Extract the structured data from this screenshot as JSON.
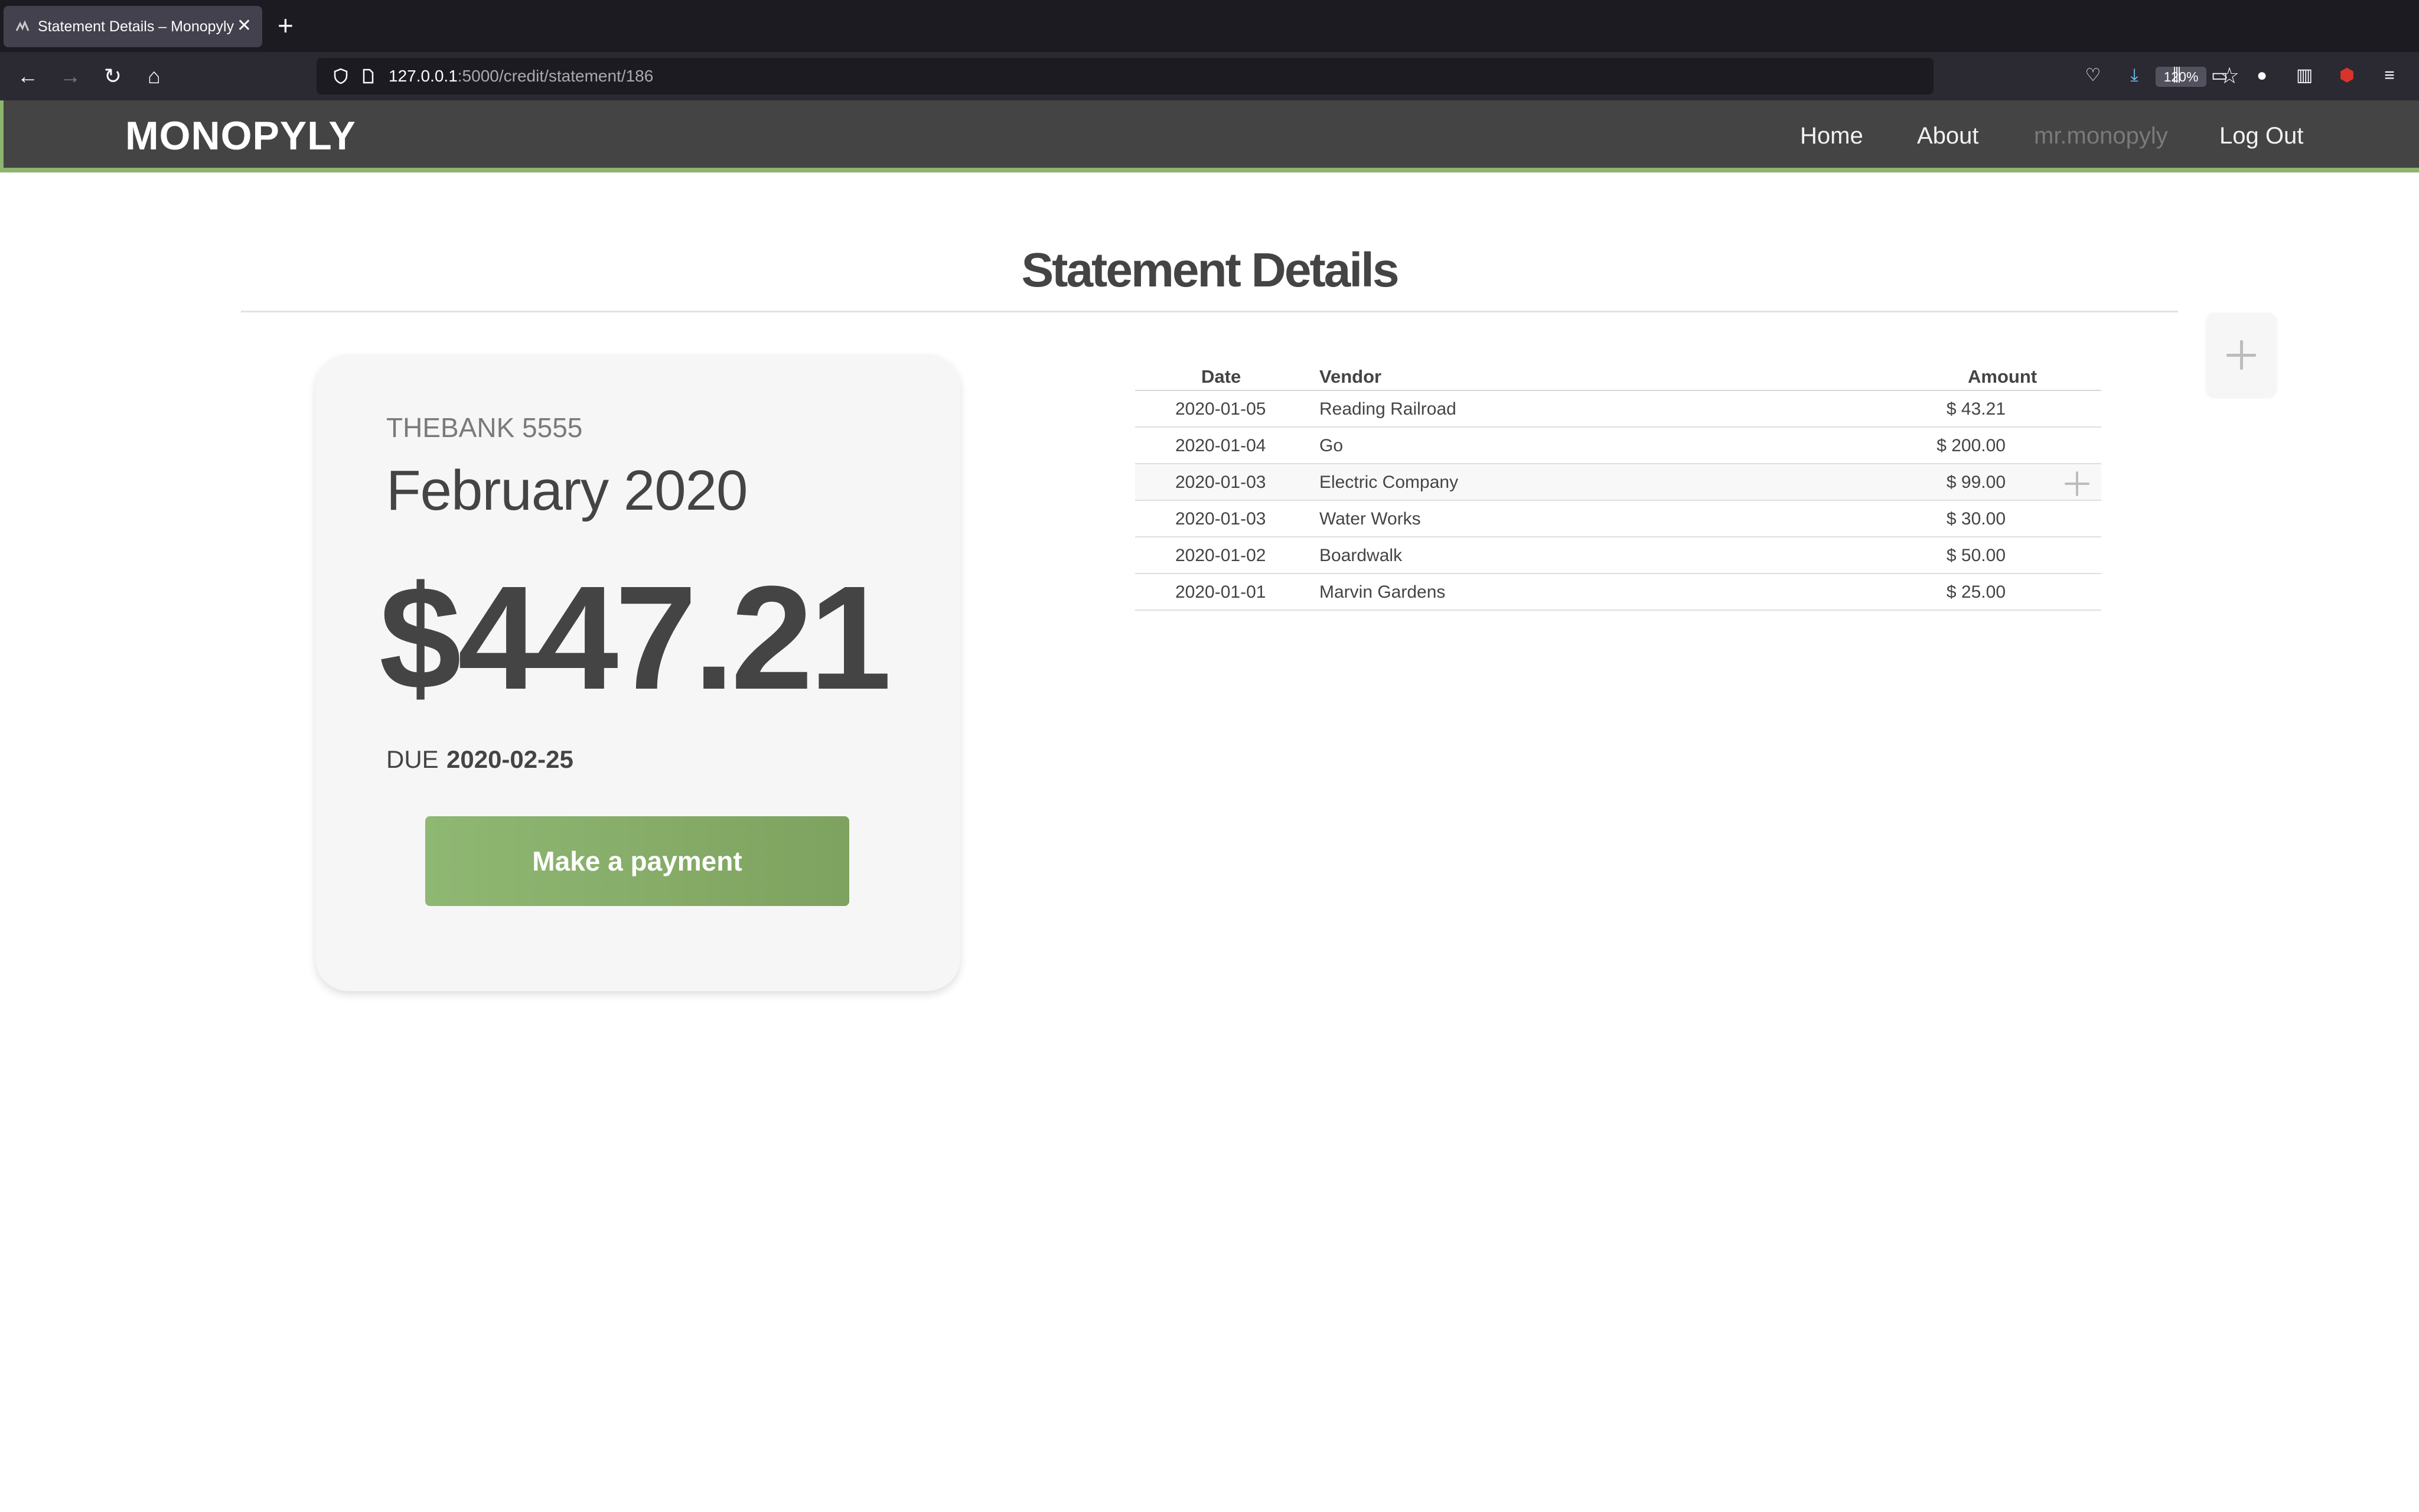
{
  "browser": {
    "tab_title": "Statement Details – Monopyly",
    "url_host": "127.0.0.1",
    "url_path": ":5000/credit/statement/186",
    "zoom": "120%"
  },
  "header": {
    "brand": "MONOPYLY",
    "nav": {
      "home": "Home",
      "about": "About",
      "user": "mr.monopyly",
      "logout": "Log Out"
    }
  },
  "page": {
    "title": "Statement Details"
  },
  "statement": {
    "card": "THEBANK 5555",
    "month": "February 2020",
    "balance": "$447.21",
    "due_label": "DUE",
    "due_date": "2020-02-25",
    "pay_label": "Make a payment"
  },
  "transactions": {
    "headers": {
      "date": "Date",
      "vendor": "Vendor",
      "amount": "Amount"
    },
    "rows": [
      {
        "date": "2020-01-05",
        "vendor": "Reading Railroad",
        "amount": "$ 43.21"
      },
      {
        "date": "2020-01-04",
        "vendor": "Go",
        "amount": "$ 200.00"
      },
      {
        "date": "2020-01-03",
        "vendor": "Electric Company",
        "amount": "$ 99.00"
      },
      {
        "date": "2020-01-03",
        "vendor": "Water Works",
        "amount": "$ 30.00"
      },
      {
        "date": "2020-01-02",
        "vendor": "Boardwalk",
        "amount": "$ 50.00"
      },
      {
        "date": "2020-01-01",
        "vendor": "Marvin Gardens",
        "amount": "$ 25.00"
      }
    ]
  },
  "colors": {
    "header_bg": "#444444",
    "accent": "#8db56e",
    "card_bg": "#f6f6f6",
    "text": "#444444"
  }
}
